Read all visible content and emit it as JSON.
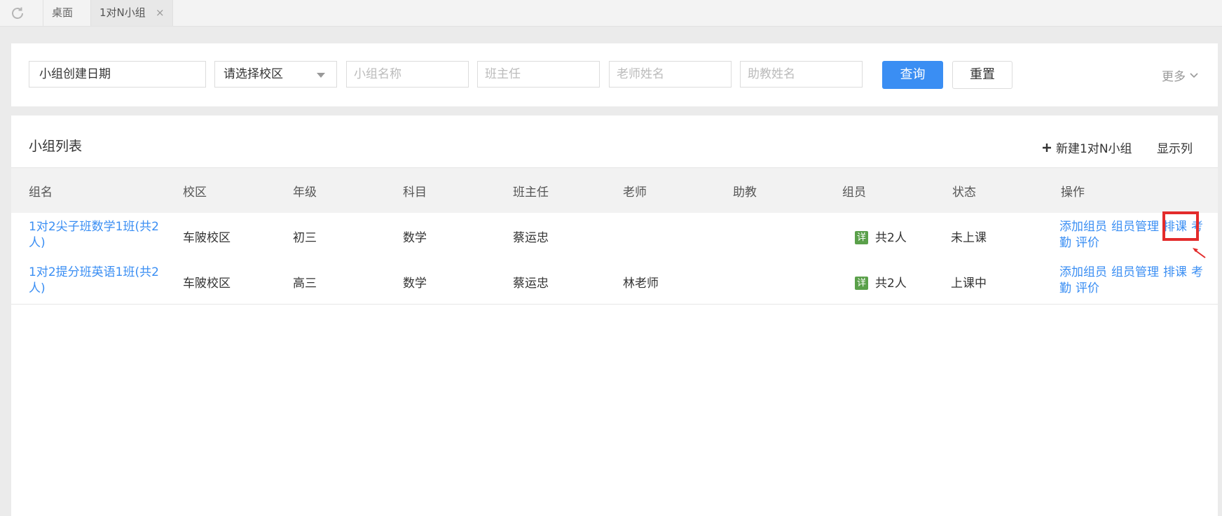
{
  "tabs": [
    {
      "label": "桌面"
    },
    {
      "label": "1对N小组"
    }
  ],
  "tab_close": "×",
  "filters": {
    "date": "小组创建日期",
    "campus_select": "请选择校区",
    "group_name_placeholder": "小组名称",
    "head_teacher_placeholder": "班主任",
    "teacher_placeholder": "老师姓名",
    "assistant_placeholder": "助教姓名",
    "query_label": "查询",
    "reset_label": "重置",
    "more_label": "更多"
  },
  "list": {
    "title": "小组列表",
    "new_label": "新建1对N小组",
    "show_cols_label": "显示列",
    "columns": [
      "组名",
      "校区",
      "年级",
      "科目",
      "班主任",
      "老师",
      "助教",
      "组员",
      "状态",
      "操作"
    ],
    "rows": [
      {
        "name_line1": "1对2尖子班数学1班(共2",
        "name_line2": "人)",
        "campus": "车陂校区",
        "grade": "初三",
        "subject": "数学",
        "head_teacher": "蔡运忠",
        "teacher": "",
        "assistant": "",
        "detail_badge": "详",
        "members": "共2人",
        "status": "未上课"
      },
      {
        "name_line1": "1对2提分班英语1班(共2",
        "name_line2": "人)",
        "campus": "车陂校区",
        "grade": "高三",
        "subject": "数学",
        "head_teacher": "蔡运忠",
        "teacher": "林老师",
        "assistant": "",
        "detail_badge": "详",
        "members": "共2人",
        "status": "上课中"
      }
    ],
    "actions": {
      "add_member": "添加组员",
      "manage_members": "组员管理",
      "schedule": "排课",
      "attendance_part1": "考",
      "attendance_part2": "勤",
      "evaluate": "评价"
    }
  },
  "colors": {
    "accent": "#3a8ef3",
    "highlight": "#e32b2b",
    "badge": "#5aa04a"
  }
}
